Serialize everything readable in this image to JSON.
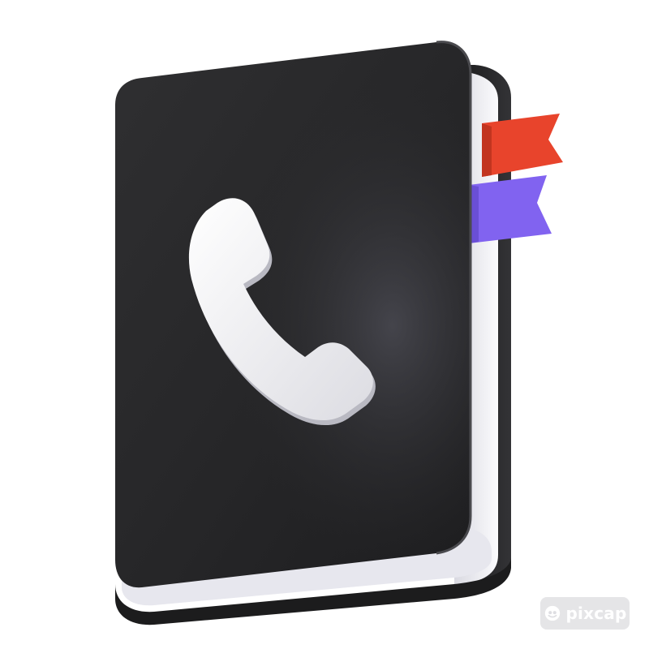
{
  "illustration": {
    "subject": "phone-book",
    "icons": [
      "phone-book-icon",
      "phone-handset-icon",
      "bookmark-ribbon-icon"
    ],
    "colors": {
      "cover": "#2a2a2b",
      "cover_highlight": "#3a3a3e",
      "pages": "#eeeef3",
      "handset": "#f1f1f4",
      "ribbon_red": "#e8442c",
      "ribbon_purple": "#8163f0"
    }
  },
  "watermark": {
    "brand": "pixcap",
    "icon": "pixcap-logo-icon"
  }
}
